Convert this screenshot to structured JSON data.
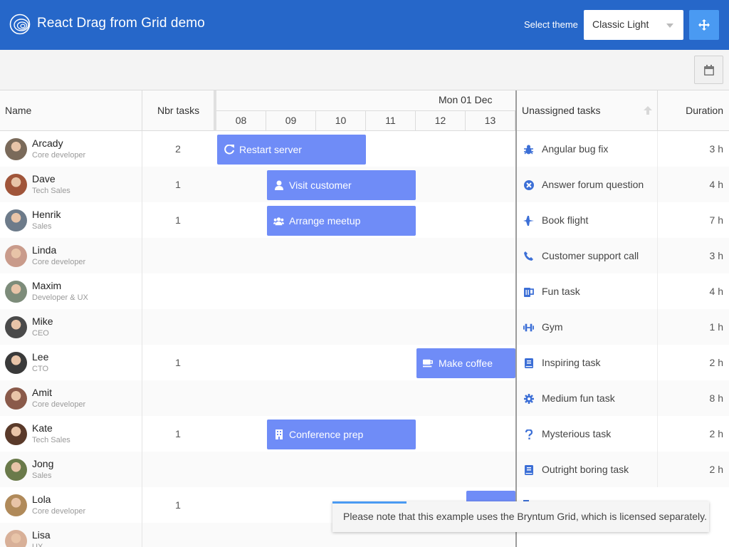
{
  "header": {
    "title": "React Drag from Grid demo",
    "theme_label": "Select theme",
    "theme_value": "Classic Light",
    "logo_icon": "bryntum-logo-icon",
    "drag_icon": "arrows-move-icon"
  },
  "toolbar": {
    "calendar_icon": "calendar-icon"
  },
  "scheduler": {
    "col_name": "Name",
    "col_tasks": "Nbr tasks",
    "date_header": "Mon 01 Dec",
    "hours": [
      "08",
      "09",
      "10",
      "11",
      "12",
      "13"
    ],
    "resources": [
      {
        "name": "Arcady",
        "role": "Core developer",
        "count": "2",
        "avatar": "#7a6a5a"
      },
      {
        "name": "Dave",
        "role": "Tech Sales",
        "count": "1",
        "avatar": "#a0553a"
      },
      {
        "name": "Henrik",
        "role": "Sales",
        "count": "1",
        "avatar": "#6d7b8a"
      },
      {
        "name": "Linda",
        "role": "Core developer",
        "count": "",
        "avatar": "#c99b8b"
      },
      {
        "name": "Maxim",
        "role": "Developer & UX",
        "count": "",
        "avatar": "#7d8c7a"
      },
      {
        "name": "Mike",
        "role": "CEO",
        "count": "",
        "avatar": "#4a4a4a"
      },
      {
        "name": "Lee",
        "role": "CTO",
        "count": "1",
        "avatar": "#3a3a3a"
      },
      {
        "name": "Amit",
        "role": "Core developer",
        "count": "",
        "avatar": "#8a5a4a"
      },
      {
        "name": "Kate",
        "role": "Tech Sales",
        "count": "1",
        "avatar": "#5a3a2a"
      },
      {
        "name": "Jong",
        "role": "Sales",
        "count": "",
        "avatar": "#6a7a4a"
      },
      {
        "name": "Lola",
        "role": "Core developer",
        "count": "1",
        "avatar": "#b08a5a"
      },
      {
        "name": "Lisa",
        "role": "UX",
        "count": "",
        "avatar": "#d8b098"
      }
    ],
    "events": [
      {
        "name": "Restart server",
        "icon": "refresh-icon"
      },
      {
        "name": "Visit customer",
        "icon": "user-icon"
      },
      {
        "name": "Arrange meetup",
        "icon": "users-icon"
      },
      {
        "name": "Make coffee",
        "icon": "coffee-icon"
      },
      {
        "name": "Conference prep",
        "icon": "building-icon"
      }
    ]
  },
  "unassigned": {
    "col_tasks": "Unassigned tasks",
    "col_duration": "Duration",
    "sort_icon": "arrow-up-icon",
    "tasks": [
      {
        "name": "Angular bug fix",
        "duration": "3 h",
        "icon": "bug-icon"
      },
      {
        "name": "Answer forum question",
        "duration": "4 h",
        "icon": "circle-x-icon"
      },
      {
        "name": "Book flight",
        "duration": "7 h",
        "icon": "plane-icon"
      },
      {
        "name": "Customer support call",
        "duration": "3 h",
        "icon": "phone-icon"
      },
      {
        "name": "Fun task",
        "duration": "4 h",
        "icon": "beer-icon"
      },
      {
        "name": "Gym",
        "duration": "1 h",
        "icon": "dumbbell-icon"
      },
      {
        "name": "Inspiring task",
        "duration": "2 h",
        "icon": "book-icon"
      },
      {
        "name": "Medium fun task",
        "duration": "8 h",
        "icon": "gear-icon"
      },
      {
        "name": "Mysterious task",
        "duration": "2 h",
        "icon": "question-icon"
      },
      {
        "name": "Outright boring task",
        "duration": "2 h",
        "icon": "book-icon"
      }
    ]
  },
  "toast": {
    "text": "Please note that this example uses the Bryntum Grid, which is licensed separately."
  },
  "colors": {
    "header_bg": "#2667c9",
    "accent": "#4a9af2",
    "event_bg": "#6f8cf7",
    "icon_blue": "#3c6fd6"
  }
}
